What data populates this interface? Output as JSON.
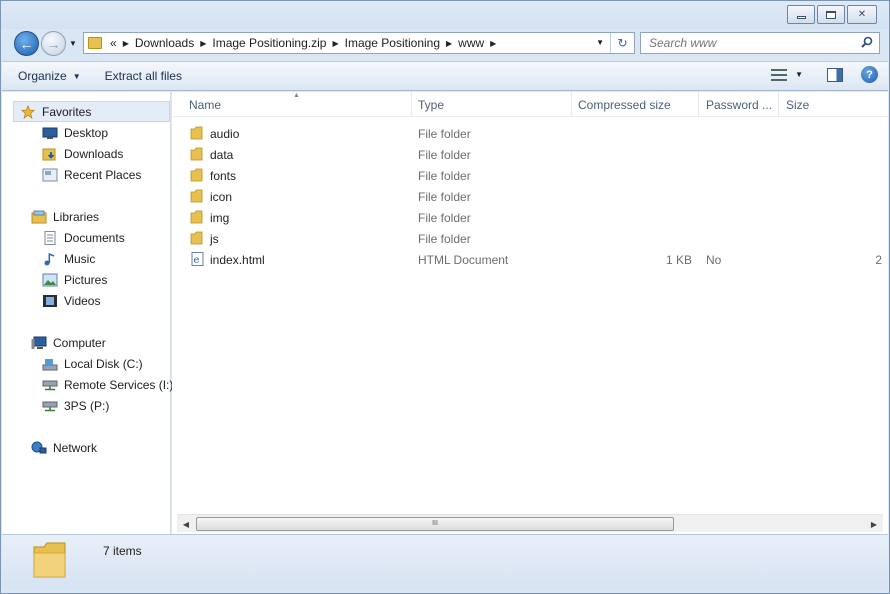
{
  "window": {
    "caption_buttons": [
      "minimize",
      "maximize",
      "close"
    ]
  },
  "address": {
    "crumbs": [
      "Downloads",
      "Image Positioning.zip",
      "Image Positioning",
      "www"
    ],
    "overflow": "«"
  },
  "search": {
    "placeholder": "Search www"
  },
  "toolbar": {
    "organize": "Organize",
    "extract": "Extract all files"
  },
  "nav": {
    "favorites": "Favorites",
    "desktop": "Desktop",
    "downloads": "Downloads",
    "recent": "Recent Places",
    "libraries": "Libraries",
    "documents": "Documents",
    "music": "Music",
    "pictures": "Pictures",
    "videos": "Videos",
    "computer": "Computer",
    "local_disk": "Local Disk (C:)",
    "remote_services": "Remote Services (I:)",
    "threeps": "3PS (P:)",
    "network": "Network"
  },
  "columns": {
    "name": "Name",
    "type": "Type",
    "compressed": "Compressed size",
    "password": "Password ...",
    "size": "Size"
  },
  "files": [
    {
      "name": "audio",
      "type": "File folder",
      "compressed": "",
      "password": "",
      "size": ""
    },
    {
      "name": "data",
      "type": "File folder",
      "compressed": "",
      "password": "",
      "size": ""
    },
    {
      "name": "fonts",
      "type": "File folder",
      "compressed": "",
      "password": "",
      "size": ""
    },
    {
      "name": "icon",
      "type": "File folder",
      "compressed": "",
      "password": "",
      "size": ""
    },
    {
      "name": "img",
      "type": "File folder",
      "compressed": "",
      "password": "",
      "size": ""
    },
    {
      "name": "js",
      "type": "File folder",
      "compressed": "",
      "password": "",
      "size": ""
    },
    {
      "name": "index.html",
      "type": "HTML Document",
      "compressed": "1 KB",
      "password": "No",
      "size": "2"
    }
  ],
  "scrollbar": {
    "grip": "III"
  },
  "status": {
    "count": "7 items"
  },
  "colors": {
    "accent": "#1b5ea8",
    "folder": "#e8c04f",
    "chrome": "#d9e6f4"
  }
}
